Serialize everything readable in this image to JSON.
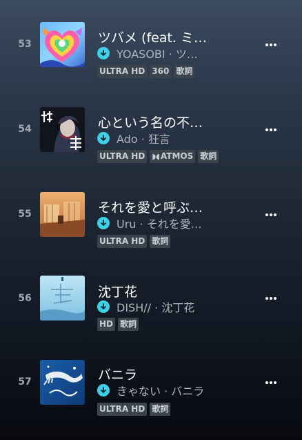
{
  "tracks": [
    {
      "rank": "53",
      "title": "ツバメ (feat. ミ…",
      "subtitle": "YOASOBI · ツ…",
      "badges": [
        "ULTRA HD",
        "360",
        "歌詞"
      ],
      "artwork": "heart-wings-artwork"
    },
    {
      "rank": "54",
      "title": "心という名の不…",
      "subtitle": "Ado · 狂言",
      "badges": [
        "ULTRA HD",
        "ATMOS",
        "歌詞"
      ],
      "artwork": "kyogen-artwork"
    },
    {
      "rank": "55",
      "title": "それを愛と呼ぶ…",
      "subtitle": "Uru · それを愛…",
      "badges": [
        "ULTRA HD",
        "歌詞"
      ],
      "artwork": "orange-room-artwork"
    },
    {
      "rank": "56",
      "title": "沈丁花",
      "subtitle": "DISH// · 沈丁花",
      "badges": [
        "HD",
        "歌詞"
      ],
      "artwork": "blue-sky-artwork"
    },
    {
      "rank": "57",
      "title": "バニラ",
      "subtitle": "きゃない · バニラ",
      "badges": [
        "ULTRA HD",
        "歌詞"
      ],
      "artwork": "blue-hand-artwork"
    }
  ],
  "icons": {
    "download": "download-check-icon",
    "more": "more-options-icon",
    "atmos": "dolby-atmos-icon"
  },
  "colors": {
    "download_accent": "#3ed0e6",
    "badge_bg": "#3b434d",
    "badge_text": "#c9ced4",
    "rank_text": "#a0a8b2"
  }
}
